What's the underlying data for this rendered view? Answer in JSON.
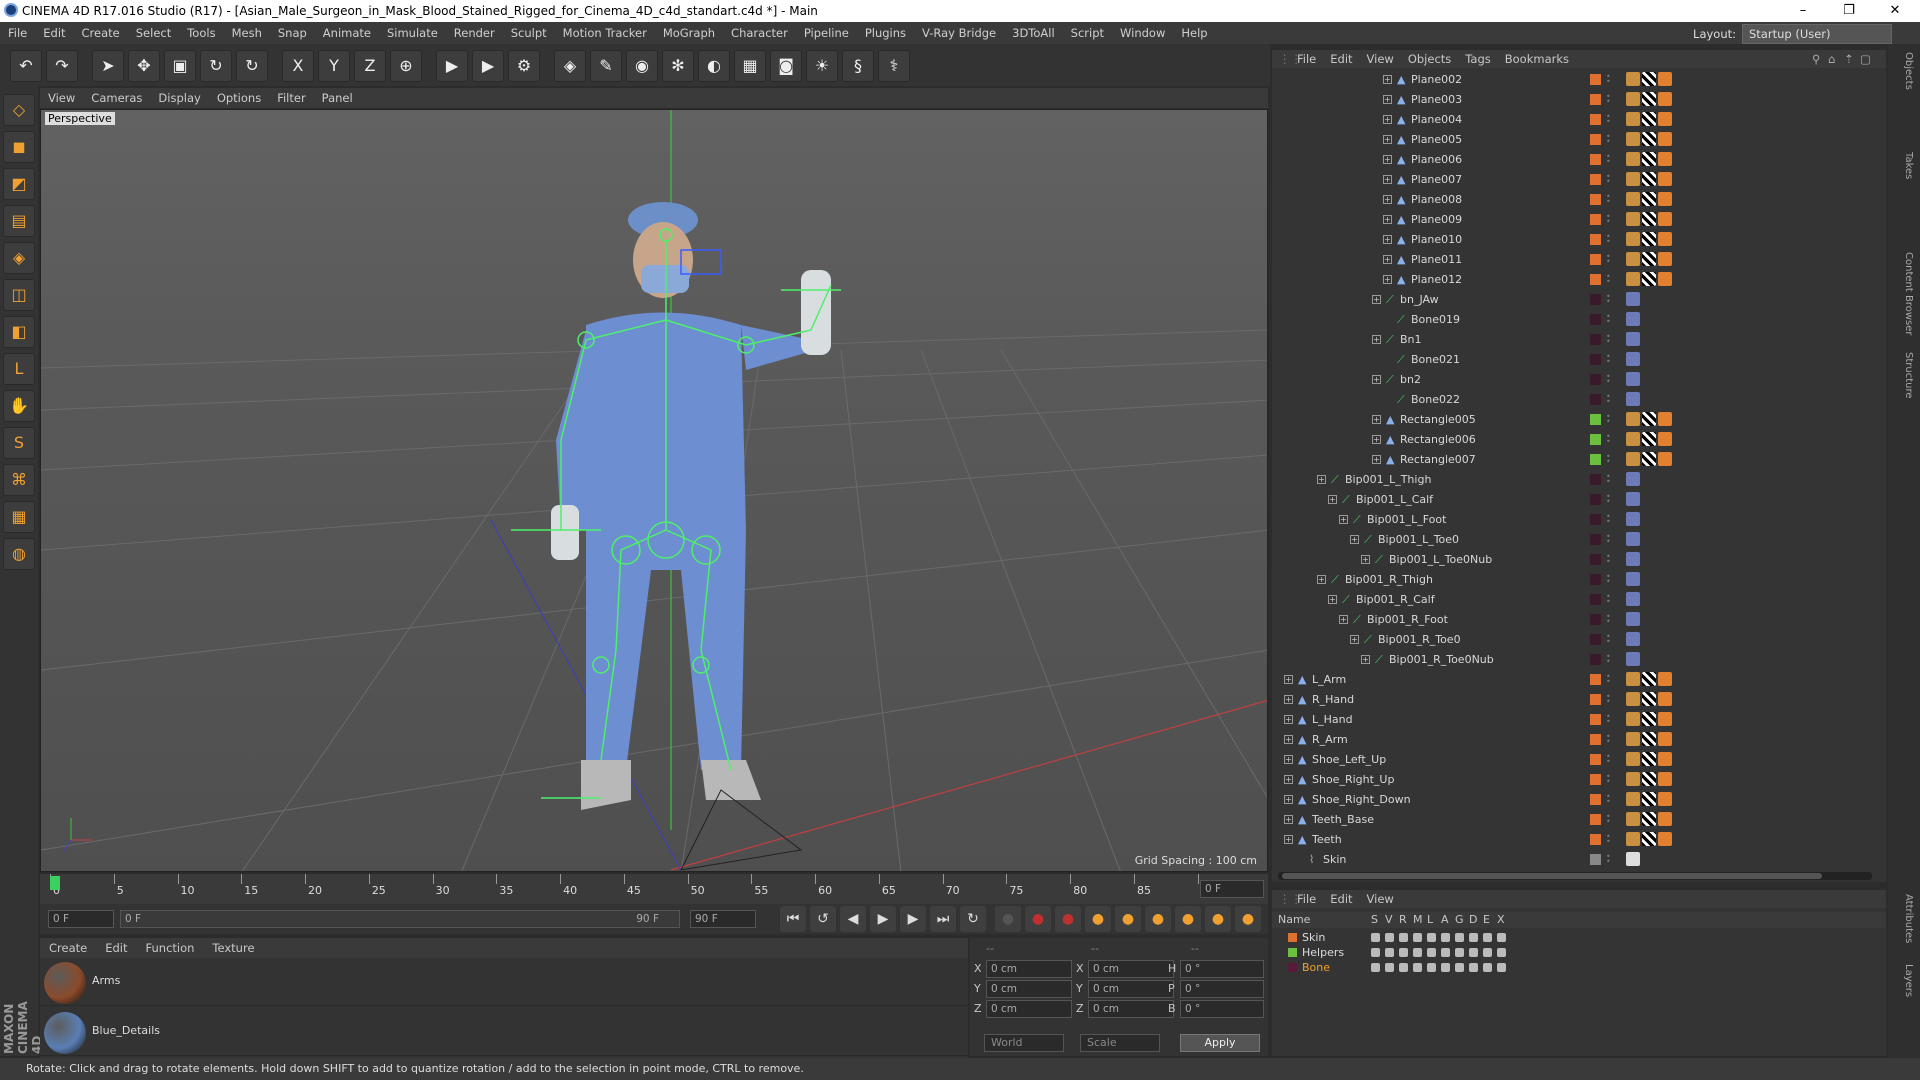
{
  "window": {
    "title": "CINEMA 4D R17.016 Studio (R17) - [Asian_Male_Surgeon_in_Mask_Blood_Stained_Rigged_for_Cinema_4D_c4d_standart.c4d *] - Main",
    "minimize": "–",
    "maximize": "❐",
    "close": "✕"
  },
  "menu": [
    "File",
    "Edit",
    "Create",
    "Select",
    "Tools",
    "Mesh",
    "Snap",
    "Animate",
    "Simulate",
    "Render",
    "Sculpt",
    "Motion Tracker",
    "MoGraph",
    "Character",
    "Pipeline",
    "Plugins",
    "V-Ray Bridge",
    "3DToAll",
    "Script",
    "Window",
    "Help"
  ],
  "layout": {
    "label": "Layout:",
    "value": "Startup (User)"
  },
  "toolbar_icons": [
    "undo-icon",
    "redo-icon",
    "select-icon",
    "move-icon",
    "scale-icon",
    "rotate-icon",
    "rotate-alt-icon",
    "x-axis-icon",
    "y-axis-icon",
    "z-axis-icon",
    "world-coord-icon",
    "render-view-icon",
    "render-pv-icon",
    "render-settings-icon",
    "cube-icon",
    "pen-icon",
    "subdivision-icon",
    "array-icon",
    "deformer-icon",
    "floor-icon",
    "camera-icon",
    "light-icon",
    "sketch-icon",
    "python-icon"
  ],
  "toolbar_glyphs": [
    "↶",
    "↷",
    "➤",
    "✥",
    "▣",
    "↻",
    "↻",
    "X",
    "Y",
    "Z",
    "⊕",
    "▶",
    "▶",
    "⚙",
    "◈",
    "✎",
    "◉",
    "✻",
    "◐",
    "▦",
    "◙",
    "☀",
    "§",
    "⚕"
  ],
  "left_tool_glyphs": [
    "◇",
    "◼",
    "◩",
    "▤",
    "◈",
    "◫",
    "◧",
    "L",
    "✋",
    "S",
    "⌘",
    "▦",
    "◍"
  ],
  "viewport": {
    "menu": [
      "View",
      "Cameras",
      "Display",
      "Options",
      "Filter",
      "Panel"
    ],
    "label": "Perspective",
    "grid_spacing": "Grid Spacing : 100 cm"
  },
  "timeline": {
    "ticks": [
      "0",
      "5",
      "10",
      "15",
      "20",
      "25",
      "30",
      "35",
      "40",
      "45",
      "50",
      "55",
      "60",
      "65",
      "70",
      "75",
      "80",
      "85",
      "90"
    ],
    "current": "0 F",
    "start": "0 F",
    "range_start": "0 F",
    "range_end": "90 F",
    "end": "90 F"
  },
  "playback_glyphs": [
    "⏮",
    "↺",
    "◀",
    "▶",
    "▶",
    "⏭",
    "↻"
  ],
  "material_manager": {
    "menu": [
      "Create",
      "Edit",
      "Function",
      "Texture"
    ],
    "materials": [
      {
        "name": "Arms",
        "color": "#8b4a2a"
      },
      {
        "name": "Blue_Details",
        "color": "#5a7fb5"
      }
    ]
  },
  "coordinates": {
    "header": [
      "--",
      "--",
      "--"
    ],
    "rows": [
      {
        "a": "X",
        "av": "0 cm",
        "b": "X",
        "bv": "0 cm",
        "c": "H",
        "cv": "0 °"
      },
      {
        "a": "Y",
        "av": "0 cm",
        "b": "Y",
        "bv": "0 cm",
        "c": "P",
        "cv": "0 °"
      },
      {
        "a": "Z",
        "av": "0 cm",
        "b": "Z",
        "bv": "0 cm",
        "c": "B",
        "cv": "0 °"
      }
    ],
    "world": "World",
    "scale": "Scale",
    "apply": "Apply"
  },
  "object_manager": {
    "menu": [
      "File",
      "Edit",
      "View",
      "Objects",
      "Tags",
      "Bookmarks"
    ],
    "objects": [
      {
        "name": "Plane002",
        "depth": 9,
        "color": "#e07030",
        "kind": "mesh"
      },
      {
        "name": "Plane003",
        "depth": 9,
        "color": "#e07030",
        "kind": "mesh"
      },
      {
        "name": "Plane004",
        "depth": 9,
        "color": "#e07030",
        "kind": "mesh"
      },
      {
        "name": "Plane005",
        "depth": 9,
        "color": "#e07030",
        "kind": "mesh"
      },
      {
        "name": "Plane006",
        "depth": 9,
        "color": "#e07030",
        "kind": "mesh"
      },
      {
        "name": "Plane007",
        "depth": 9,
        "color": "#e07030",
        "kind": "mesh"
      },
      {
        "name": "Plane008",
        "depth": 9,
        "color": "#e07030",
        "kind": "mesh"
      },
      {
        "name": "Plane009",
        "depth": 9,
        "color": "#e07030",
        "kind": "mesh"
      },
      {
        "name": "Plane010",
        "depth": 9,
        "color": "#e07030",
        "kind": "mesh"
      },
      {
        "name": "Plane011",
        "depth": 9,
        "color": "#e07030",
        "kind": "mesh"
      },
      {
        "name": "Plane012",
        "depth": 9,
        "color": "#e07030",
        "kind": "mesh"
      },
      {
        "name": "bn_JAw",
        "depth": 8,
        "color": "#3a1a2a",
        "kind": "bone"
      },
      {
        "name": "Bone019",
        "depth": 9,
        "color": "#3a1a2a",
        "kind": "bone"
      },
      {
        "name": "Bn1",
        "depth": 8,
        "color": "#3a1a2a",
        "kind": "bone"
      },
      {
        "name": "Bone021",
        "depth": 9,
        "color": "#3a1a2a",
        "kind": "bone"
      },
      {
        "name": "bn2",
        "depth": 8,
        "color": "#3a1a2a",
        "kind": "bone"
      },
      {
        "name": "Bone022",
        "depth": 9,
        "color": "#3a1a2a",
        "kind": "bone"
      },
      {
        "name": "Rectangle005",
        "depth": 8,
        "color": "#6cc040",
        "kind": "mesh"
      },
      {
        "name": "Rectangle006",
        "depth": 8,
        "color": "#6cc040",
        "kind": "mesh"
      },
      {
        "name": "Rectangle007",
        "depth": 8,
        "color": "#6cc040",
        "kind": "mesh"
      },
      {
        "name": "Bip001_L_Thigh",
        "depth": 3,
        "color": "#3a1a2a",
        "kind": "bone"
      },
      {
        "name": "Bip001_L_Calf",
        "depth": 4,
        "color": "#3a1a2a",
        "kind": "bone"
      },
      {
        "name": "Bip001_L_Foot",
        "depth": 5,
        "color": "#3a1a2a",
        "kind": "bone"
      },
      {
        "name": "Bip001_L_Toe0",
        "depth": 6,
        "color": "#3a1a2a",
        "kind": "bone"
      },
      {
        "name": "Bip001_L_Toe0Nub",
        "depth": 7,
        "color": "#3a1a2a",
        "kind": "bone"
      },
      {
        "name": "Bip001_R_Thigh",
        "depth": 3,
        "color": "#3a1a2a",
        "kind": "bone"
      },
      {
        "name": "Bip001_R_Calf",
        "depth": 4,
        "color": "#3a1a2a",
        "kind": "bone"
      },
      {
        "name": "Bip001_R_Foot",
        "depth": 5,
        "color": "#3a1a2a",
        "kind": "bone"
      },
      {
        "name": "Bip001_R_Toe0",
        "depth": 6,
        "color": "#3a1a2a",
        "kind": "bone"
      },
      {
        "name": "Bip001_R_Toe0Nub",
        "depth": 7,
        "color": "#3a1a2a",
        "kind": "bone"
      },
      {
        "name": "L_Arm",
        "depth": 0,
        "color": "#e07030",
        "kind": "mesh"
      },
      {
        "name": "R_Hand",
        "depth": 0,
        "color": "#e07030",
        "kind": "mesh"
      },
      {
        "name": "L_Hand",
        "depth": 0,
        "color": "#e07030",
        "kind": "mesh"
      },
      {
        "name": "R_Arm",
        "depth": 0,
        "color": "#e07030",
        "kind": "mesh"
      },
      {
        "name": "Shoe_Left_Up",
        "depth": 0,
        "color": "#e07030",
        "kind": "mesh"
      },
      {
        "name": "Shoe_Right_Up",
        "depth": 0,
        "color": "#e07030",
        "kind": "mesh"
      },
      {
        "name": "Shoe_Right_Down",
        "depth": 0,
        "color": "#e07030",
        "kind": "mesh"
      },
      {
        "name": "Teeth_Base",
        "depth": 0,
        "color": "#e07030",
        "kind": "mesh"
      },
      {
        "name": "Teeth",
        "depth": 0,
        "color": "#e07030",
        "kind": "mesh"
      },
      {
        "name": "Skin",
        "depth": 1,
        "color": "#888888",
        "kind": "skin"
      }
    ]
  },
  "layer_manager": {
    "menu": [
      "File",
      "Edit",
      "View"
    ],
    "columns": [
      "Name",
      "S",
      "V",
      "R",
      "M",
      "L",
      "A",
      "G",
      "D",
      "E",
      "X"
    ],
    "layers": [
      {
        "name": "Skin",
        "color": "#e07030",
        "active": false
      },
      {
        "name": "Helpers",
        "color": "#6cc040",
        "active": false
      },
      {
        "name": "Bone",
        "color": "#5a1a3a",
        "active": true
      }
    ]
  },
  "right_tabs": [
    "Objects",
    "Takes",
    "Content Browser",
    "Structure"
  ],
  "right_tabs_bottom": [
    "Attributes",
    "Layers"
  ],
  "status": "Rotate: Click and drag to rotate elements. Hold down SHIFT to add to quantize rotation / add to the selection in point mode, CTRL to remove.",
  "brand": "MAXON CINEMA 4D"
}
